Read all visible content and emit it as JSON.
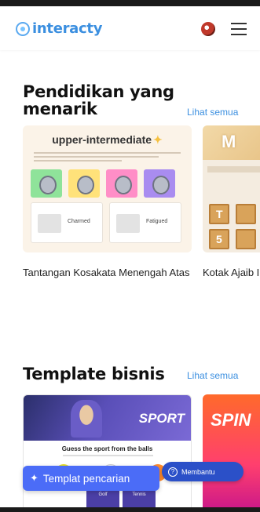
{
  "header": {
    "logo_text": "interacty",
    "avatar_icon": "avatar",
    "menu_icon": "hamburger-menu-icon"
  },
  "education": {
    "title": "Pendidikan yang menarik",
    "see_all": "Lihat semua",
    "card1": {
      "banner_title": "upper-intermediate",
      "answer1": "Charmed",
      "answer2": "Fatigued",
      "caption": "Tantangan Kosakata Menengah Atas"
    },
    "card2": {
      "banner_letter": "M",
      "box1": "T",
      "box2": "5",
      "caption": "Kotak Ajaib Inggris untu"
    }
  },
  "business": {
    "title": "Template bisnis",
    "see_all": "Lihat semua",
    "card3": {
      "banner_word": "SPORT",
      "question": "Guess the sport from the balls",
      "option1": "Golf",
      "option2": "Tennis"
    },
    "card4": {
      "banner_word": "SPIN"
    }
  },
  "floating": {
    "search_template": "Templat pencarian",
    "help": "Membantu"
  },
  "colors": {
    "accent": "#3b8fe0",
    "search_button": "#4b6cf7",
    "help_button": "#2b50c8"
  }
}
